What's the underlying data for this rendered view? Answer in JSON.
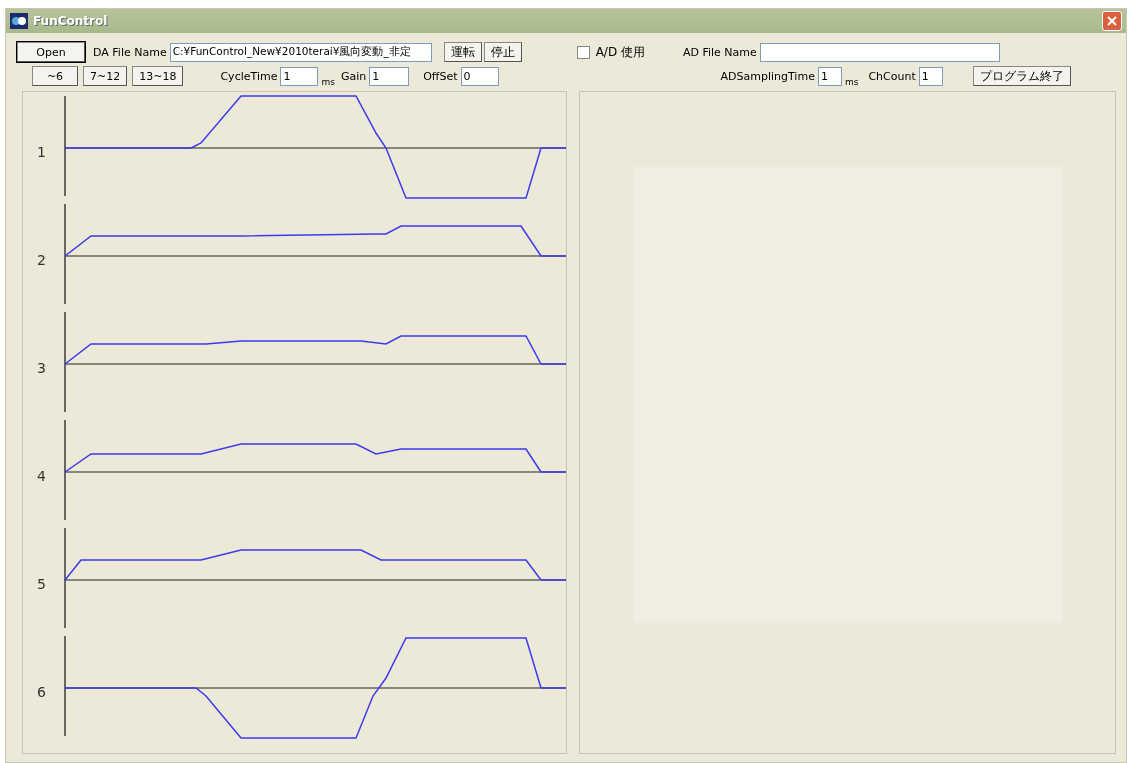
{
  "window": {
    "title": "FunControl"
  },
  "toolbar": {
    "open_button": "Open",
    "da_file_label": "DA File Name",
    "da_file_value": "C:¥FunControl_New¥2010terai¥風向変動_非定",
    "run_button": "運転",
    "stop_button": "停止",
    "ad_checkbox": {
      "label": "A/D 使用",
      "checked": false
    },
    "ad_file_label": "AD File Name",
    "range_buttons": [
      "~6",
      "7~12",
      "13~18"
    ],
    "cycle_time_label": "CycleTime",
    "cycle_time_value": "1",
    "cycle_time_unit": "ms",
    "gain_label": "Gain",
    "gain_value": "1",
    "offset_label": "OffSet",
    "offset_value": "0",
    "ad_sampling_label": "ADSamplingTime",
    "ad_sampling_value": "1",
    "ad_sampling_unit": "ms",
    "ch_count_label": "ChCount",
    "ch_count_value": "1",
    "exit_button": "プログラム終了"
  },
  "channels": [
    {
      "label": "1"
    },
    {
      "label": "2"
    },
    {
      "label": "3"
    },
    {
      "label": "4"
    },
    {
      "label": "5"
    },
    {
      "label": "6"
    }
  ]
}
